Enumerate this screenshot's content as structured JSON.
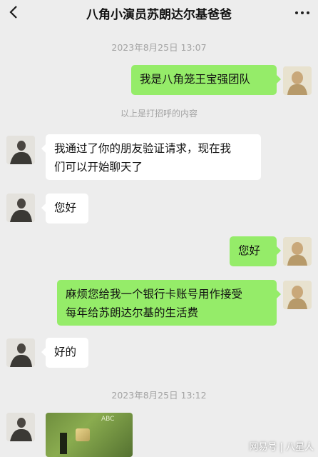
{
  "header": {
    "back_icon": "chevron-left-icon",
    "title": "八角小演员苏朗达尔基爸爸",
    "more_icon": "more-dots-icon"
  },
  "messages": {
    "timestamp_1": "2023年8月25日 13:07",
    "self_1": "我是八角笼王宝强团队",
    "notice": "以上是打招呼的内容",
    "other_1_line1": "我通过了你的朋友验证请求，现在我",
    "other_1_line2": "们可以开始聊天了",
    "other_2": "您好",
    "self_2": "您好",
    "self_3_line1": "麻烦您给我一个银行卡账号用作接受",
    "self_3_line2": "每年给苏朗达尔基的生活费",
    "other_3": "好的",
    "timestamp_2": "2023年8月25日 13:12",
    "image_caption": "ABC"
  },
  "watermark": "网易号 | 八星人",
  "colors": {
    "background": "#ededed",
    "self_bubble": "#95ec69",
    "other_bubble": "#ffffff",
    "timestamp_text": "#a3a3a3"
  }
}
